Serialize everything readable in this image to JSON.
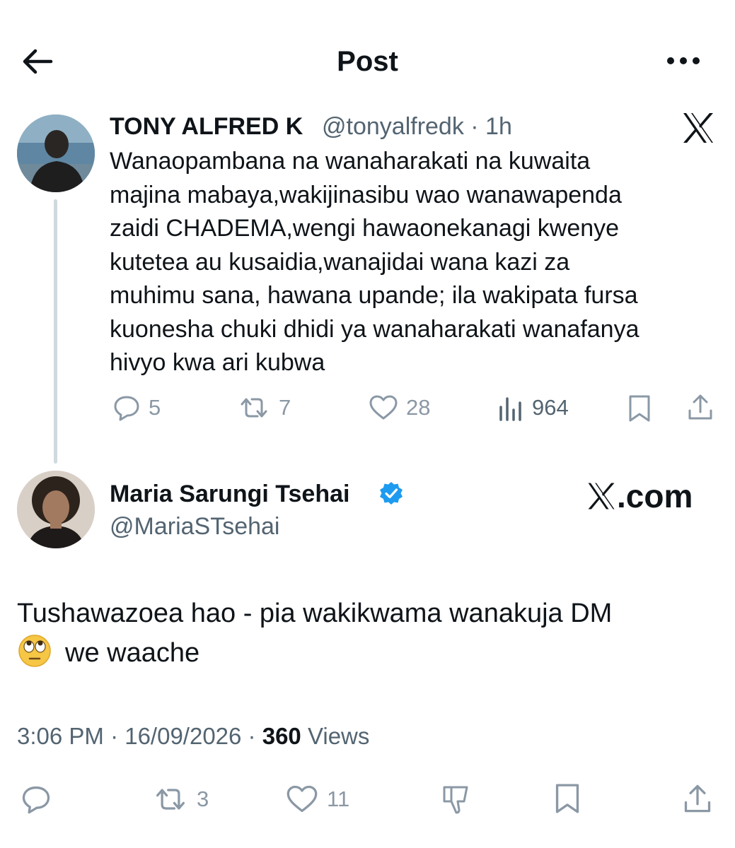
{
  "header": {
    "title": "Post",
    "back_icon": "arrow-left-icon",
    "more_icon": "more-horizontal-icon"
  },
  "parent_post": {
    "name": "TONY ALFRED K",
    "handle_time": "@tonyalfredk · 1h",
    "text_lines": [
      "Wanaopambana na wanaharakati na kuwaita",
      "majina mabaya,wakijinasibu wao wanawapenda",
      "zaidi CHADEMA,wengi hawaonekanagi kwenye",
      "kutetea au kusaidia,wanajidai wana kazi za",
      "muhimu sana, hawana upande; ila wakipata fursa",
      "kuonesha chuki dhidi ya wanaharakati wanafanya",
      "hivyo kwa ari kubwa"
    ],
    "replies": "5",
    "reposts": "7",
    "likes": "28",
    "views": "964"
  },
  "watermark": {
    "text": ".com"
  },
  "main_post": {
    "name": "Maria Sarungi Tsehai",
    "handle": "@MariaSTsehai",
    "text_line1": "Tushawazoea hao - pia wakikwama wanakuja DM",
    "text_line2": "we waache",
    "emoji": "face-with-rolling-eyes",
    "time_date": "3:06 PM · 16/09/2026 · ",
    "views_count": "360",
    "views_label": " Views",
    "reposts": "3",
    "likes": "11"
  },
  "colors": {
    "verified": "#1d9bf0",
    "muted": "#8b98a5",
    "secondary": "#536471",
    "text": "#0f1419"
  }
}
